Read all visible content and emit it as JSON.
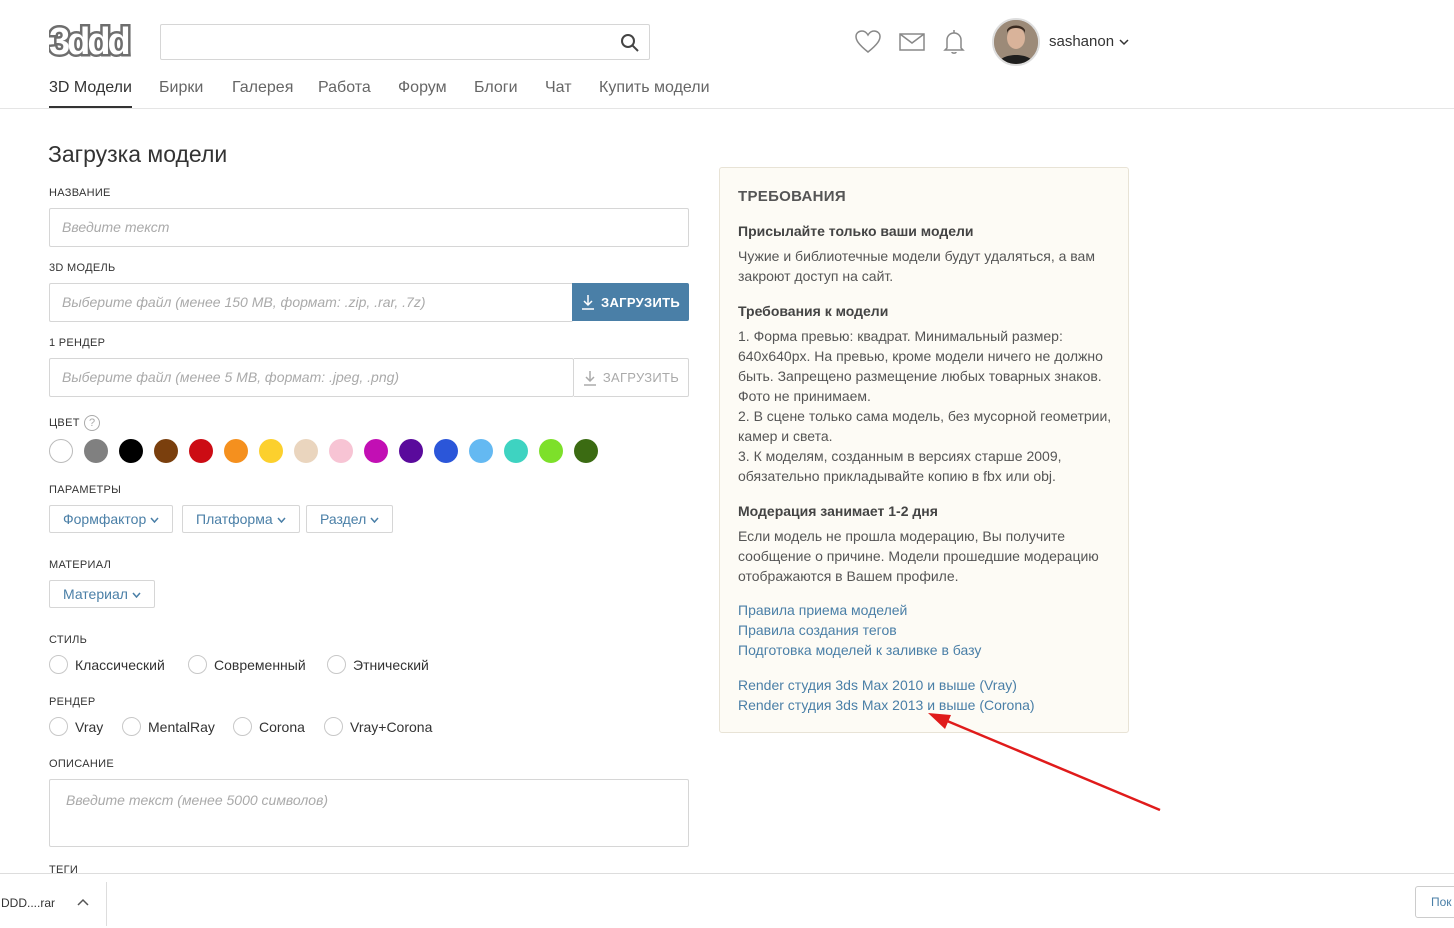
{
  "header": {
    "logo_text": "3ddd",
    "search_placeholder": "",
    "username": "sashanon"
  },
  "nav": [
    {
      "label": "3D Модели",
      "active": true
    },
    {
      "label": "Бирки"
    },
    {
      "label": "Галерея"
    },
    {
      "label": "Работа"
    },
    {
      "label": "Форум"
    },
    {
      "label": "Блоги"
    },
    {
      "label": "Чат"
    },
    {
      "label": "Купить модели"
    }
  ],
  "form": {
    "title": "Загрузка модели",
    "name_label": "НАЗВАНИЕ",
    "name_placeholder": "Введите текст",
    "model_label": "3D МОДЕЛЬ",
    "model_placeholder": "Выберите файл (менее 150 MB, формат: .zip, .rar, .7z)",
    "model_button": "ЗАГРУЗИТЬ",
    "render_label": "1 РЕНДЕР",
    "render_placeholder": "Выберите файл (менее 5 MB, формат: .jpeg, .png)",
    "render_button": "ЗАГРУЗИТЬ",
    "color_label": "ЦВЕТ",
    "help_glyph": "?",
    "colors": [
      "#ffffff",
      "#808080",
      "#000000",
      "#7a3f0d",
      "#cc0c14",
      "#f5901e",
      "#fcd02d",
      "#ead5be",
      "#f7c4d4",
      "#c20fb4",
      "#5a0a9c",
      "#2b56d9",
      "#64b9f2",
      "#3ed3c1",
      "#7de02a",
      "#3b6b12"
    ],
    "params_label": "ПАРАМЕТРЫ",
    "params": [
      "Формфактор",
      "Платформа",
      "Раздел"
    ],
    "material_label": "МАТЕРИАЛ",
    "material": "Материал",
    "style_label": "СТИЛЬ",
    "styles": [
      "Классический",
      "Современный",
      "Этнический"
    ],
    "render_engine_label": "РЕНДЕР",
    "render_engines": [
      "Vray",
      "MentalRay",
      "Corona",
      "Vray+Corona"
    ],
    "description_label": "ОПИСАНИЕ",
    "description_placeholder": "Введите текст (менее 5000 символов)",
    "tags_label": "ТЕГИ"
  },
  "requirements": {
    "title": "ТРЕБОВАНИЯ",
    "sections": [
      {
        "heading": "Присылайте только ваши модели",
        "text": "Чужие и библиотечные модели будут удаляться, а вам закроют доступ на сайт."
      },
      {
        "heading": "Требования к модели",
        "text": "1. Форма превью: квадрат. Минимальный размер: 640x640px. На превью, кроме модели ничего не должно быть. Запрещено размещение любых товарных знаков. Фото не принимаем.\n2. В сцене только сама модель, без мусорной геометрии, камер и света.\n3. К моделям, созданным в версиях старше 2009, обязательно прикладывайте копию в fbx или obj."
      },
      {
        "heading": "Модерация занимает 1-2 дня",
        "text": "Если модель не прошла модерацию, Вы получите сообщение о причине. Модели прошедшие модерацию отображаются в Вашем профиле."
      }
    ],
    "links": [
      "Правила приема моделей",
      "Правила создания тегов",
      "Подготовка моделей к заливке в базу",
      "Render студия 3ds Max 2010 и выше (Vray)",
      "Render студия 3ds Max 2013 и выше (Corona)"
    ]
  },
  "download_bar": {
    "file_name": "DDD....rar",
    "button_label": "Пок"
  },
  "annotation": {
    "arrow_color": "#e01b1b"
  }
}
